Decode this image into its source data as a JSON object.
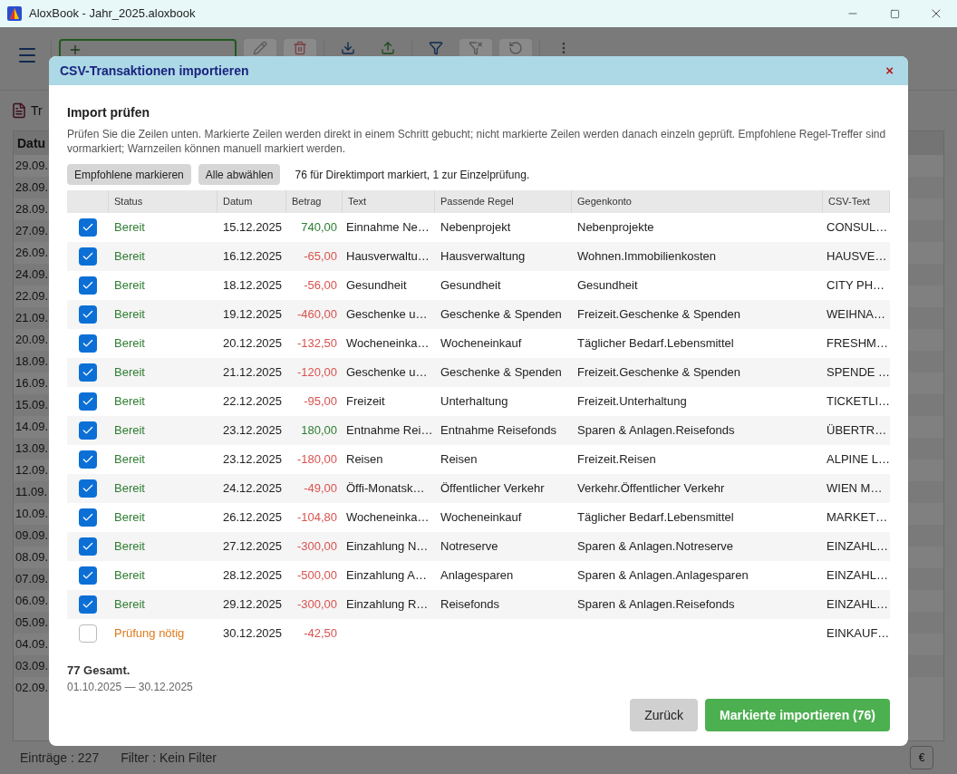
{
  "window": {
    "title": "AloxBook - Jahr_2025.aloxbook"
  },
  "background": {
    "tab": "Tr",
    "column": "Datu",
    "dates": [
      "29.09.",
      "28.09.",
      "28.09.",
      "27.09.",
      "26.09.",
      "24.09.",
      "22.09.",
      "21.09.",
      "20.09.",
      "18.09.",
      "16.09.",
      "15.09.",
      "14.09.",
      "13.09.",
      "12.09.",
      "11.09.",
      "10.09.",
      "09.09.",
      "08.09.",
      "07.09.",
      "06.09.",
      "05.09.",
      "04.09.",
      "03.09.",
      "02.09."
    ]
  },
  "status_bar": {
    "entries": "Einträge : 227",
    "filter": "Filter : Kein Filter",
    "currency": "€"
  },
  "dialog": {
    "title": "CSV-Transaktionen importieren",
    "close": "×",
    "heading": "Import prüfen",
    "description": "Prüfen Sie die Zeilen unten. Markierte Zeilen werden direkt in einem Schritt gebucht; nicht markierte Zeilen werden danach einzeln geprüft. Empfohlene Regel-Treffer sind vormarkiert; Warnzeilen können manuell markiert werden.",
    "buttons": [
      "Empfohlene markieren",
      "Alle abwählen"
    ],
    "summary": "76 für Direktimport markiert, 1 zur Einzelprüfung.",
    "columns": [
      "Status",
      "Datum",
      "Betrag",
      "Text",
      "Passende Regel",
      "Gegenkonto",
      "CSV-Text"
    ],
    "rows": [
      {
        "checked": true,
        "needs_review": false,
        "status": "Bereit",
        "date": "15.12.2025",
        "amount": "740,00",
        "income": true,
        "text": "Einnahme Ne…",
        "rule": "Nebenprojekt",
        "account": "Nebenprojekte",
        "csv": "CONSUL…"
      },
      {
        "checked": true,
        "needs_review": false,
        "status": "Bereit",
        "date": "16.12.2025",
        "amount": "-65,00",
        "income": false,
        "text": "Hausverwaltu…",
        "rule": "Hausverwaltung",
        "account": "Wohnen.Immobilienkosten",
        "csv": "HAUSVE…"
      },
      {
        "checked": true,
        "needs_review": false,
        "status": "Bereit",
        "date": "18.12.2025",
        "amount": "-56,00",
        "income": false,
        "text": "Gesundheit",
        "rule": "Gesundheit",
        "account": "Gesundheit",
        "csv": "CITY PH…"
      },
      {
        "checked": true,
        "needs_review": false,
        "status": "Bereit",
        "date": "19.12.2025",
        "amount": "-460,00",
        "income": false,
        "text": "Geschenke u…",
        "rule": "Geschenke & Spenden",
        "account": "Freizeit.Geschenke & Spenden",
        "csv": "WEIHNA…"
      },
      {
        "checked": true,
        "needs_review": false,
        "status": "Bereit",
        "date": "20.12.2025",
        "amount": "-132,50",
        "income": false,
        "text": "Wocheneinka…",
        "rule": "Wocheneinkauf",
        "account": "Täglicher Bedarf.Lebensmittel",
        "csv": "FRESHM…"
      },
      {
        "checked": true,
        "needs_review": false,
        "status": "Bereit",
        "date": "21.12.2025",
        "amount": "-120,00",
        "income": false,
        "text": "Geschenke u…",
        "rule": "Geschenke & Spenden",
        "account": "Freizeit.Geschenke & Spenden",
        "csv": "SPENDE …"
      },
      {
        "checked": true,
        "needs_review": false,
        "status": "Bereit",
        "date": "22.12.2025",
        "amount": "-95,00",
        "income": false,
        "text": "Freizeit",
        "rule": "Unterhaltung",
        "account": "Freizeit.Unterhaltung",
        "csv": "TICKETLI…"
      },
      {
        "checked": true,
        "needs_review": false,
        "status": "Bereit",
        "date": "23.12.2025",
        "amount": "180,00",
        "income": true,
        "text": "Entnahme Rei…",
        "rule": "Entnahme Reisefonds",
        "account": "Sparen & Anlagen.Reisefonds",
        "csv": "ÜBERTR…"
      },
      {
        "checked": true,
        "needs_review": false,
        "status": "Bereit",
        "date": "23.12.2025",
        "amount": "-180,00",
        "income": false,
        "text": "Reisen",
        "rule": "Reisen",
        "account": "Freizeit.Reisen",
        "csv": "ALPINE L…"
      },
      {
        "checked": true,
        "needs_review": false,
        "status": "Bereit",
        "date": "24.12.2025",
        "amount": "-49,00",
        "income": false,
        "text": "Öffi-Monatsk…",
        "rule": "Öffentlicher Verkehr",
        "account": "Verkehr.Öffentlicher Verkehr",
        "csv": "WIEN M…"
      },
      {
        "checked": true,
        "needs_review": false,
        "status": "Bereit",
        "date": "26.12.2025",
        "amount": "-104,80",
        "income": false,
        "text": "Wocheneinka…",
        "rule": "Wocheneinkauf",
        "account": "Täglicher Bedarf.Lebensmittel",
        "csv": "MARKET…"
      },
      {
        "checked": true,
        "needs_review": false,
        "status": "Bereit",
        "date": "27.12.2025",
        "amount": "-300,00",
        "income": false,
        "text": "Einzahlung N…",
        "rule": "Notreserve",
        "account": "Sparen & Anlagen.Notreserve",
        "csv": "EINZAHL…"
      },
      {
        "checked": true,
        "needs_review": false,
        "status": "Bereit",
        "date": "28.12.2025",
        "amount": "-500,00",
        "income": false,
        "text": "Einzahlung A…",
        "rule": "Anlagesparen",
        "account": "Sparen & Anlagen.Anlagesparen",
        "csv": "EINZAHL…"
      },
      {
        "checked": true,
        "needs_review": false,
        "status": "Bereit",
        "date": "29.12.2025",
        "amount": "-300,00",
        "income": false,
        "text": "Einzahlung R…",
        "rule": "Reisefonds",
        "account": "Sparen & Anlagen.Reisefonds",
        "csv": "EINZAHL…"
      },
      {
        "checked": false,
        "needs_review": true,
        "status": "Prüfung nötig",
        "date": "30.12.2025",
        "amount": "-42,50",
        "income": false,
        "csv": "EINKAUF…"
      }
    ],
    "total": "77 Gesamt.",
    "range": "01.10.2025 — 30.12.2025",
    "back": "Zurück",
    "import": "Markierte importieren (76)"
  }
}
